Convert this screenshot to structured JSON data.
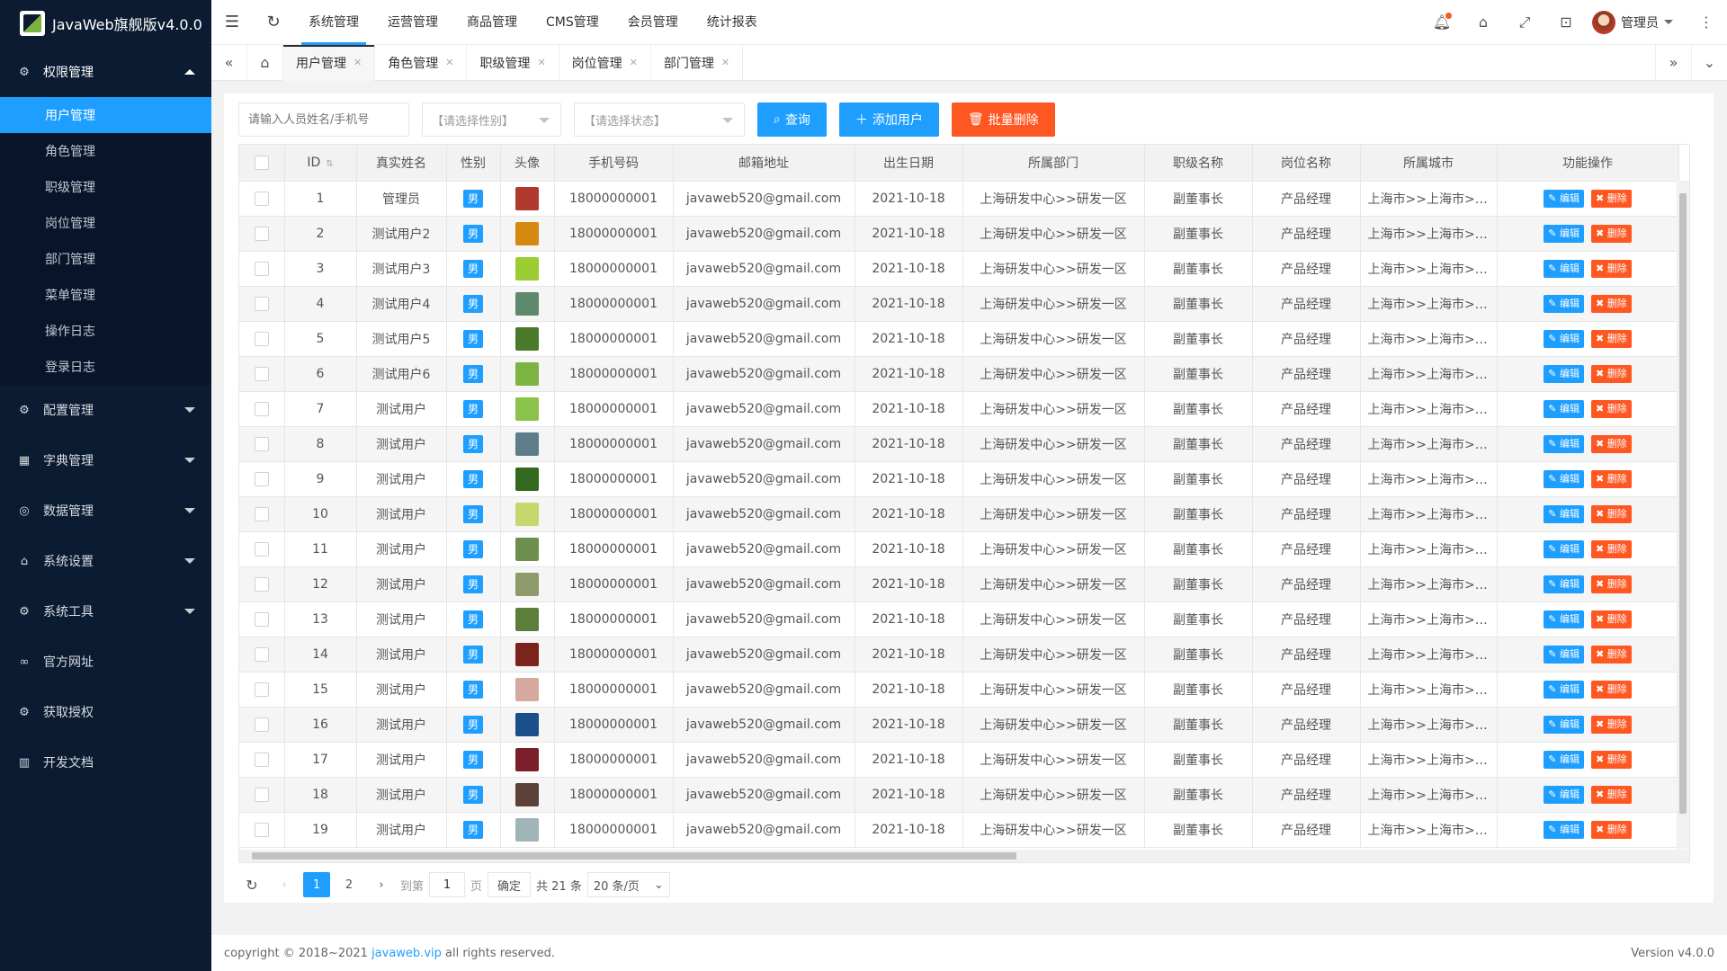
{
  "app": {
    "title": "JavaWeb旗舰版v4.0.0"
  },
  "sidebar": {
    "groups": [
      {
        "label": "权限管理",
        "icon": "gear-icon",
        "open": true,
        "items": [
          {
            "label": "用户管理",
            "active": true
          },
          {
            "label": "角色管理"
          },
          {
            "label": "职级管理"
          },
          {
            "label": "岗位管理"
          },
          {
            "label": "部门管理"
          },
          {
            "label": "菜单管理"
          },
          {
            "label": "操作日志"
          },
          {
            "label": "登录日志"
          }
        ]
      },
      {
        "label": "配置管理",
        "icon": "settings-icon"
      },
      {
        "label": "字典管理",
        "icon": "dictionary-icon"
      },
      {
        "label": "数据管理",
        "icon": "data-icon"
      },
      {
        "label": "系统设置",
        "icon": "home-icon"
      },
      {
        "label": "系统工具",
        "icon": "tools-icon"
      },
      {
        "label": "官方网址",
        "icon": "link-icon"
      },
      {
        "label": "获取授权",
        "icon": "license-icon"
      },
      {
        "label": "开发文档",
        "icon": "docs-icon"
      }
    ]
  },
  "header": {
    "nav": [
      "系统管理",
      "运营管理",
      "商品管理",
      "CMS管理",
      "会员管理",
      "统计报表"
    ],
    "active_nav": 0,
    "user_name": "管理员"
  },
  "tabs": [
    "用户管理",
    "角色管理",
    "职级管理",
    "岗位管理",
    "部门管理"
  ],
  "filters": {
    "search_placeholder": "请输入人员姓名/手机号",
    "gender_placeholder": "【请选择性别】",
    "status_placeholder": "【请选择状态】",
    "query_label": "查询",
    "add_label": "添加用户",
    "batch_delete_label": "批量删除"
  },
  "table": {
    "columns": [
      "ID",
      "真实姓名",
      "性别",
      "头像",
      "手机号码",
      "邮箱地址",
      "出生日期",
      "所属部门",
      "职级名称",
      "岗位名称",
      "所属城市",
      "功能操作"
    ],
    "edit_label": "编辑",
    "delete_label": "删除",
    "rows": [
      {
        "id": "1",
        "name": "管理员",
        "sex": "男",
        "phone": "18000000001",
        "email": "javaweb520@gmail.com",
        "birth": "2021-10-18",
        "dept": "上海研发中心>>研发一区",
        "level": "副董事长",
        "post": "产品经理",
        "city": "上海市>>上海市>>浦东新区",
        "avatar_color": "#b03a2e"
      },
      {
        "id": "2",
        "name": "测试用户2",
        "sex": "男",
        "phone": "18000000001",
        "email": "javaweb520@gmail.com",
        "birth": "2021-10-18",
        "dept": "上海研发中心>>研发一区",
        "level": "副董事长",
        "post": "产品经理",
        "city": "上海市>>上海市>>浦东新区",
        "avatar_color": "#d68910"
      },
      {
        "id": "3",
        "name": "测试用户3",
        "sex": "男",
        "phone": "18000000001",
        "email": "javaweb520@gmail.com",
        "birth": "2021-10-18",
        "dept": "上海研发中心>>研发一区",
        "level": "副董事长",
        "post": "产品经理",
        "city": "上海市>>上海市>>浦东新区",
        "avatar_color": "#9acd32"
      },
      {
        "id": "4",
        "name": "测试用户4",
        "sex": "男",
        "phone": "18000000001",
        "email": "javaweb520@gmail.com",
        "birth": "2021-10-18",
        "dept": "上海研发中心>>研发一区",
        "level": "副董事长",
        "post": "产品经理",
        "city": "上海市>>上海市>>浦东新区",
        "avatar_color": "#5d8a6a"
      },
      {
        "id": "5",
        "name": "测试用户5",
        "sex": "男",
        "phone": "18000000001",
        "email": "javaweb520@gmail.com",
        "birth": "2021-10-18",
        "dept": "上海研发中心>>研发一区",
        "level": "副董事长",
        "post": "产品经理",
        "city": "上海市>>上海市>>浦东新区",
        "avatar_color": "#4a7a2a"
      },
      {
        "id": "6",
        "name": "测试用户6",
        "sex": "男",
        "phone": "18000000001",
        "email": "javaweb520@gmail.com",
        "birth": "2021-10-18",
        "dept": "上海研发中心>>研发一区",
        "level": "副董事长",
        "post": "产品经理",
        "city": "上海市>>上海市>>浦东新区",
        "avatar_color": "#7cb342"
      },
      {
        "id": "7",
        "name": "测试用户",
        "sex": "男",
        "phone": "18000000001",
        "email": "javaweb520@gmail.com",
        "birth": "2021-10-18",
        "dept": "上海研发中心>>研发一区",
        "level": "副董事长",
        "post": "产品经理",
        "city": "上海市>>上海市>>浦东新区",
        "avatar_color": "#8bc34a"
      },
      {
        "id": "8",
        "name": "测试用户",
        "sex": "男",
        "phone": "18000000001",
        "email": "javaweb520@gmail.com",
        "birth": "2021-10-18",
        "dept": "上海研发中心>>研发一区",
        "level": "副董事长",
        "post": "产品经理",
        "city": "上海市>>上海市>>浦东新区",
        "avatar_color": "#607d8b"
      },
      {
        "id": "9",
        "name": "测试用户",
        "sex": "男",
        "phone": "18000000001",
        "email": "javaweb520@gmail.com",
        "birth": "2021-10-18",
        "dept": "上海研发中心>>研发一区",
        "level": "副董事长",
        "post": "产品经理",
        "city": "上海市>>上海市>>浦东新区",
        "avatar_color": "#33691e"
      },
      {
        "id": "10",
        "name": "测试用户",
        "sex": "男",
        "phone": "18000000001",
        "email": "javaweb520@gmail.com",
        "birth": "2021-10-18",
        "dept": "上海研发中心>>研发一区",
        "level": "副董事长",
        "post": "产品经理",
        "city": "上海市>>上海市>>浦东新区",
        "avatar_color": "#c5d86d"
      },
      {
        "id": "11",
        "name": "测试用户",
        "sex": "男",
        "phone": "18000000001",
        "email": "javaweb520@gmail.com",
        "birth": "2021-10-18",
        "dept": "上海研发中心>>研发一区",
        "level": "副董事长",
        "post": "产品经理",
        "city": "上海市>>上海市>>浦东新区",
        "avatar_color": "#6d8f4e"
      },
      {
        "id": "12",
        "name": "测试用户",
        "sex": "男",
        "phone": "18000000001",
        "email": "javaweb520@gmail.com",
        "birth": "2021-10-18",
        "dept": "上海研发中心>>研发一区",
        "level": "副董事长",
        "post": "产品经理",
        "city": "上海市>>上海市>>浦东新区",
        "avatar_color": "#8d9a6a"
      },
      {
        "id": "13",
        "name": "测试用户",
        "sex": "男",
        "phone": "18000000001",
        "email": "javaweb520@gmail.com",
        "birth": "2021-10-18",
        "dept": "上海研发中心>>研发一区",
        "level": "副董事长",
        "post": "产品经理",
        "city": "上海市>>上海市>>浦东新区",
        "avatar_color": "#5b7f3a"
      },
      {
        "id": "14",
        "name": "测试用户",
        "sex": "男",
        "phone": "18000000001",
        "email": "javaweb520@gmail.com",
        "birth": "2021-10-18",
        "dept": "上海研发中心>>研发一区",
        "level": "副董事长",
        "post": "产品经理",
        "city": "上海市>>上海市>>浦东新区",
        "avatar_color": "#7b241c"
      },
      {
        "id": "15",
        "name": "测试用户",
        "sex": "男",
        "phone": "18000000001",
        "email": "javaweb520@gmail.com",
        "birth": "2021-10-18",
        "dept": "上海研发中心>>研发一区",
        "level": "副董事长",
        "post": "产品经理",
        "city": "上海市>>上海市>>浦东新区",
        "avatar_color": "#d7a8a0"
      },
      {
        "id": "16",
        "name": "测试用户",
        "sex": "男",
        "phone": "18000000001",
        "email": "javaweb520@gmail.com",
        "birth": "2021-10-18",
        "dept": "上海研发中心>>研发一区",
        "level": "副董事长",
        "post": "产品经理",
        "city": "上海市>>上海市>>浦东新区",
        "avatar_color": "#1a4f8a"
      },
      {
        "id": "17",
        "name": "测试用户",
        "sex": "男",
        "phone": "18000000001",
        "email": "javaweb520@gmail.com",
        "birth": "2021-10-18",
        "dept": "上海研发中心>>研发一区",
        "level": "副董事长",
        "post": "产品经理",
        "city": "上海市>>上海市>>浦东新区",
        "avatar_color": "#7b1f2b"
      },
      {
        "id": "18",
        "name": "测试用户",
        "sex": "男",
        "phone": "18000000001",
        "email": "javaweb520@gmail.com",
        "birth": "2021-10-18",
        "dept": "上海研发中心>>研发一区",
        "level": "副董事长",
        "post": "产品经理",
        "city": "上海市>>上海市>>浦东新区",
        "avatar_color": "#5d4037"
      },
      {
        "id": "19",
        "name": "测试用户",
        "sex": "男",
        "phone": "18000000001",
        "email": "javaweb520@gmail.com",
        "birth": "2021-10-18",
        "dept": "上海研发中心>>研发一区",
        "level": "副董事长",
        "post": "产品经理",
        "city": "上海市>>上海市>>浦东新区",
        "avatar_color": "#9fb5b8"
      }
    ]
  },
  "pager": {
    "pages": [
      "1",
      "2"
    ],
    "current": "1",
    "goto_label": "到第",
    "page_value": "1",
    "page_unit": "页",
    "confirm_label": "确定",
    "total_label": "共 21 条",
    "page_size": "20 条/页"
  },
  "footer": {
    "copyright": "copyright © 2018~2021",
    "link": "javaweb.vip",
    "rights": "all rights reserved.",
    "version": "Version v4.0.0"
  },
  "colors": {
    "accent": "#1e9fff",
    "danger": "#ff5722",
    "sidebar_bg": "#0b1b31"
  }
}
